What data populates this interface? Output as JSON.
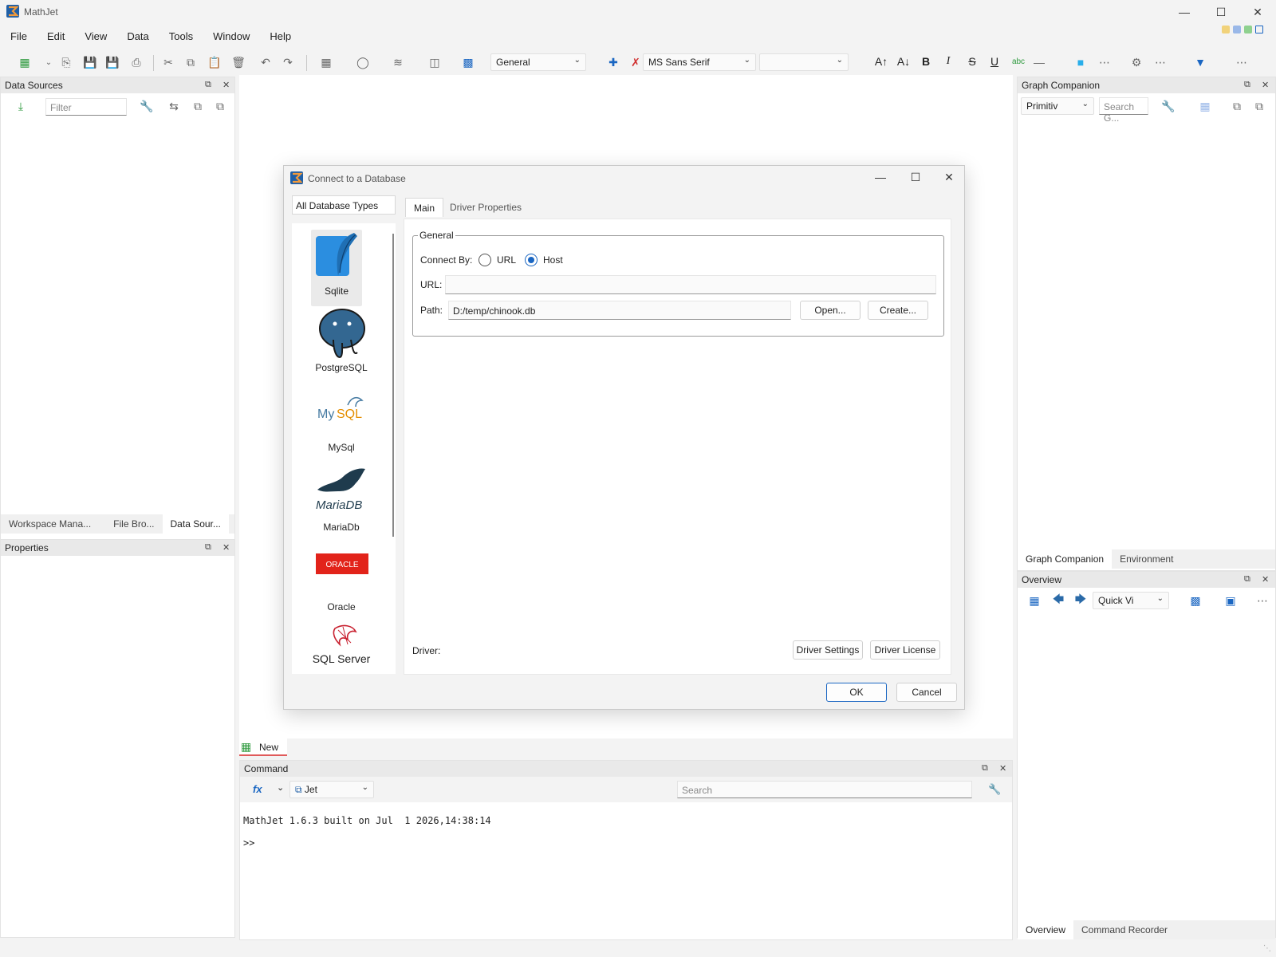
{
  "app": {
    "title": "MathJet"
  },
  "menu": [
    "File",
    "Edit",
    "View",
    "Data",
    "Tools",
    "Window",
    "Help"
  ],
  "toolbar": {
    "style_combo": "General",
    "font_combo": "MS Sans Serif",
    "size_combo": ""
  },
  "left": {
    "data_sources_title": "Data Sources",
    "filter_placeholder": "Filter",
    "tabs": [
      "Workspace Mana...",
      "File Bro...",
      "Data Sour..."
    ],
    "properties_title": "Properties"
  },
  "right": {
    "graph_companion_title": "Graph Companion",
    "primitive_combo": "Primitiv",
    "search_placeholder": "Search G...",
    "tabs_top": [
      "Graph Companion",
      "Environment"
    ],
    "overview_title": "Overview",
    "quick_view_combo": "Quick Vi",
    "tabs_bottom": [
      "Overview",
      "Command Recorder"
    ]
  },
  "dialog": {
    "title": "Connect to a Database",
    "db_types_header": "All Database Types",
    "db_types": [
      "Sqlite",
      "PostgreSQL",
      "MySql",
      "MariaDb",
      "Oracle",
      "SQL Server"
    ],
    "tabs": [
      "Main",
      "Driver Properties"
    ],
    "general_legend": "General",
    "connect_by_label": "Connect By:",
    "radio_url": "URL",
    "radio_host": "Host",
    "connect_by_selected": "Host",
    "url_label": "URL:",
    "url_value": "",
    "path_label": "Path:",
    "path_value": "D:/temp/chinook.db",
    "open_button": "Open...",
    "create_button": "Create...",
    "driver_label": "Driver:",
    "driver_settings_button": "Driver Settings",
    "driver_license_button": "Driver License",
    "ok_button": "OK",
    "cancel_button": "Cancel"
  },
  "doc_tab": {
    "label": "New"
  },
  "command": {
    "title": "Command",
    "engine_combo": "Jet",
    "search_placeholder": "Search",
    "output_line": "MathJet 1.6.3 built on Jul  1 2026,14:38:14",
    "prompt": ">>"
  },
  "colors": {
    "accent": "#1a66c2",
    "panel_header": "#e9e9e9",
    "tab_underline": "#e05a5a"
  }
}
